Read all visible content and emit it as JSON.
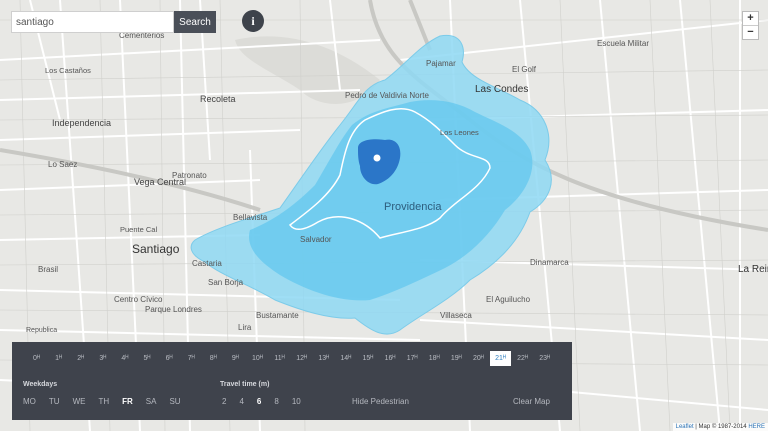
{
  "search": {
    "value": "santiago",
    "placeholder": "santiago",
    "button_label": "Search"
  },
  "info": {
    "label": "i"
  },
  "zoom": {
    "in_label": "+",
    "out_label": "−"
  },
  "map": {
    "labels": {
      "santiago": "Santiago",
      "providencia": "Providencia",
      "las_condes": "Las Condes",
      "independencia": "Independencia",
      "recoleta": "Recoleta",
      "lo_saez": "Lo Saez",
      "los_castanos": "Los Castaños",
      "cementerios": "Cementerios",
      "patronato": "Patronato",
      "vega_central": "Vega Central",
      "bellavista": "Bellavista",
      "castaria": "Castaria",
      "san_borja": "San Borja",
      "parque_londres": "Parque Londres",
      "centro_civico": "Centro Cívico",
      "brasil": "Brasil",
      "republica": "Republica",
      "lira": "Lira",
      "bustamante": "Bustamante",
      "el_aguilucho": "El Aguilucho",
      "villaseca": "Villaseca",
      "dinamarca": "Dinamarca",
      "la_reina": "La Reina",
      "el_golf": "El Golf",
      "los_leones": "Los Leones",
      "pedro_de_valdivia_norte": "Pedro de Valdivia Norte",
      "escuela_militar": "Escuela Militar",
      "salvador": "Salvador",
      "puente_cal": "Puente Cal",
      "pajamar": "Pajamar"
    }
  },
  "panel": {
    "hours": [
      "0ᴴ",
      "1ᴴ",
      "2ᴴ",
      "3ᴴ",
      "4ᴴ",
      "5ᴴ",
      "6ᴴ",
      "7ᴴ",
      "8ᴴ",
      "9ᴴ",
      "10ᴴ",
      "11ᴴ",
      "12ᴴ",
      "13ᴴ",
      "14ᴴ",
      "15ᴴ",
      "16ᴴ",
      "17ᴴ",
      "18ᴴ",
      "19ᴴ",
      "20ᴴ",
      "21ᴴ",
      "22ᴴ",
      "23ᴴ"
    ],
    "selected_hour": 21,
    "weekdays_label": "Weekdays",
    "weekdays": [
      "MO",
      "TU",
      "WE",
      "TH",
      "FR",
      "SA",
      "SU"
    ],
    "selected_weekday": "FR",
    "travel_time_label": "Travel time (m)",
    "travel_times": [
      "2",
      "4",
      "6",
      "8",
      "10"
    ],
    "selected_travel_time": "6",
    "hide_pedestrian": "Hide Pedestrian",
    "clear_map": "Clear Map"
  },
  "attribution": {
    "leaflet": "Leaflet",
    "text": "| Map © 1987-2014",
    "here": "HERE"
  },
  "colors": {
    "isochrone_light": "#8ed8f3",
    "isochrone_mid": "#5fc6ee",
    "center_area": "#2b76c8",
    "panel_bg": "#3f434c",
    "selected_hour_text": "#2f7fbf"
  }
}
